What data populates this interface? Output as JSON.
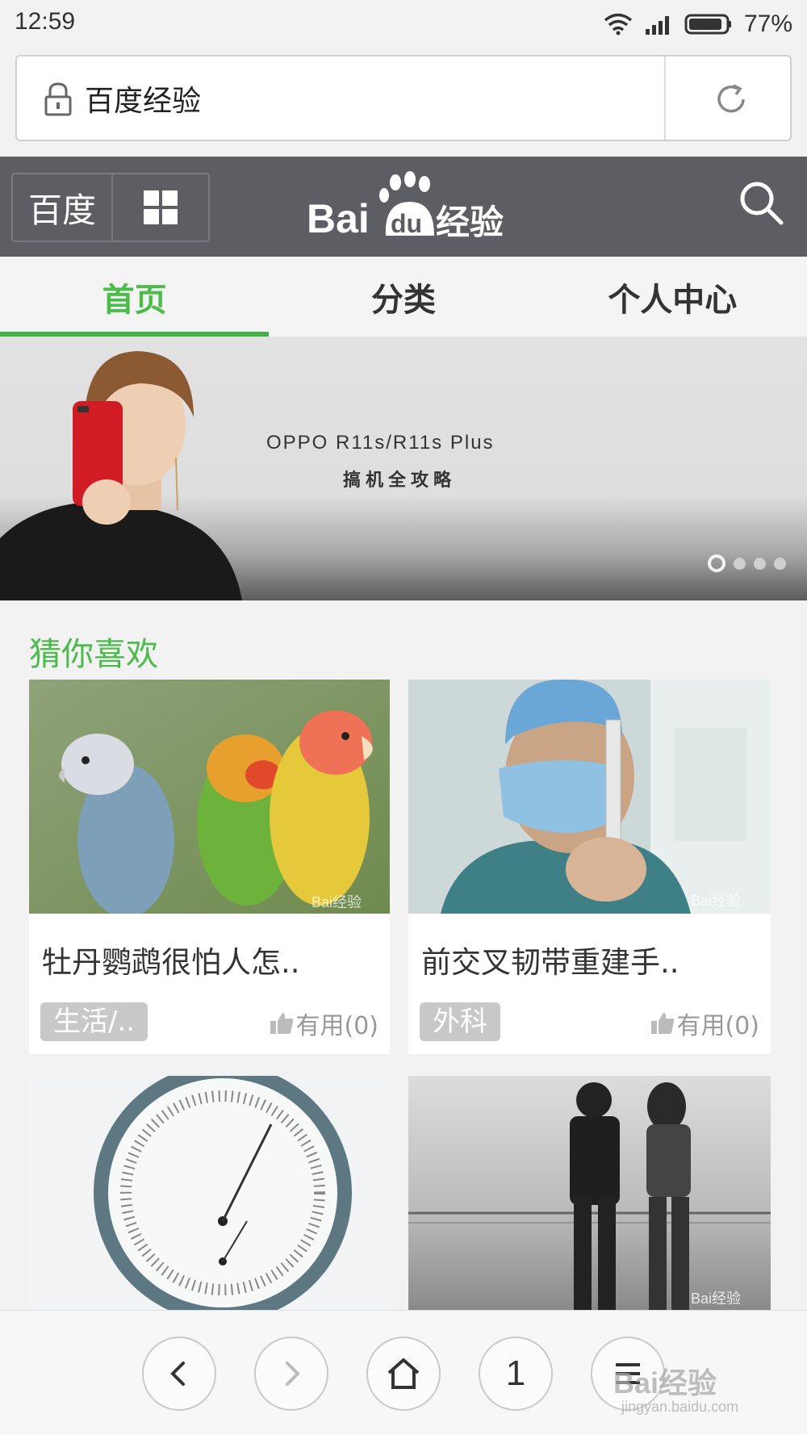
{
  "status_bar": {
    "time": "12:59",
    "battery": "77%",
    "icons": [
      "wifi-icon",
      "signal-icon",
      "battery-icon"
    ]
  },
  "address_bar": {
    "text": "百度经验",
    "icons": [
      "lock-icon",
      "reload-icon"
    ]
  },
  "header": {
    "baidu_button": "百度",
    "logo_text": "经验",
    "logo_brand": "Bai",
    "logo_du": "du",
    "icons": [
      "grid-icon",
      "search-icon"
    ],
    "color": "#5d5e63"
  },
  "tabs": [
    {
      "label": "首页",
      "active": true
    },
    {
      "label": "分类",
      "active": false
    },
    {
      "label": "个人中心",
      "active": false
    }
  ],
  "accent_color": "#4cbb4c",
  "banner": {
    "title": "OPPO R11s/R11s Plus",
    "subtitle": "搞机全攻略",
    "slide_count": 4,
    "active_slide": 1
  },
  "section": {
    "title": "猜你喜欢"
  },
  "cards": [
    {
      "title": "牡丹鹦鹉很怕人怎..",
      "tag": "生活/..",
      "useful": "有用(0)",
      "image": "parrots",
      "watermark": "Bai经验"
    },
    {
      "title": "前交叉韧带重建手..",
      "tag": "外科",
      "useful": "有用(0)",
      "image": "surgeon",
      "watermark": "Bai经验"
    },
    {
      "title": "",
      "tag": "",
      "useful": "",
      "image": "hygrometer"
    },
    {
      "title": "",
      "tag": "",
      "useful": "",
      "image": "couple",
      "watermark": "Bai经验"
    }
  ],
  "bottom_nav": {
    "buttons": [
      "back-icon",
      "forward-icon",
      "home-icon",
      "tabs-button",
      "menu-icon"
    ],
    "tab_count": "1"
  },
  "watermark": {
    "text": "Bai经验",
    "url": "jingyan.baidu.com"
  }
}
